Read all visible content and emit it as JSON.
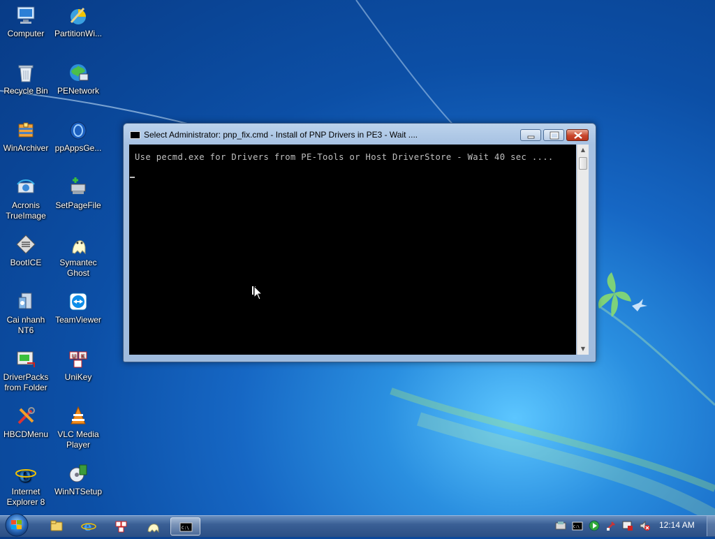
{
  "desktop": {
    "icons": [
      {
        "label": "Computer",
        "icon": "computer-icon"
      },
      {
        "label": "PartitionWi...",
        "icon": "partition-wizard-icon"
      },
      {
        "label": "Recycle Bin",
        "icon": "recycle-bin-icon"
      },
      {
        "label": "PENetwork",
        "icon": "network-icon"
      },
      {
        "label": "WinArchiver",
        "icon": "archiver-icon"
      },
      {
        "label": "ppAppsGe...",
        "icon": "apps-icon"
      },
      {
        "label": "Acronis TrueImage",
        "icon": "acronis-icon"
      },
      {
        "label": "SetPageFile",
        "icon": "pagefile-icon"
      },
      {
        "label": "BootICE",
        "icon": "bootice-icon"
      },
      {
        "label": "Symantec Ghost",
        "icon": "ghost-icon"
      },
      {
        "label": "Cai nhanh NT6",
        "icon": "install-icon"
      },
      {
        "label": "TeamViewer",
        "icon": "teamviewer-icon"
      },
      {
        "label": "DriverPacks from Folder",
        "icon": "driverpacks-icon"
      },
      {
        "label": "UniKey",
        "icon": "unikey-icon"
      },
      {
        "label": "HBCDMenu",
        "icon": "tools-icon"
      },
      {
        "label": "VLC Media Player",
        "icon": "vlc-icon"
      },
      {
        "label": "Internet Explorer 8",
        "icon": "ie-icon"
      },
      {
        "label": "WinNTSetup",
        "icon": "setup-icon"
      }
    ]
  },
  "window": {
    "title": "Select Administrator:  pnp_fix.cmd - Install of PNP Drivers in PE3 - Wait ....",
    "console_line": "Use pecmd.exe for Drivers from PE-Tools or Host DriverStore - Wait 40 sec ...."
  },
  "taskbar": {
    "clock": "12:14 AM",
    "pinned": [
      "explorer-icon",
      "ie-icon",
      "unikey-icon",
      "ghost-icon",
      "cmd-icon"
    ],
    "tray": [
      "network-icon",
      "cmd-icon",
      "media-icon",
      "tool-icon",
      "display-icon",
      "volume-muted-icon"
    ]
  },
  "colors": {
    "console_bg": "#000000",
    "console_text": "#c0c0c0",
    "close_button": "#c8452c"
  }
}
